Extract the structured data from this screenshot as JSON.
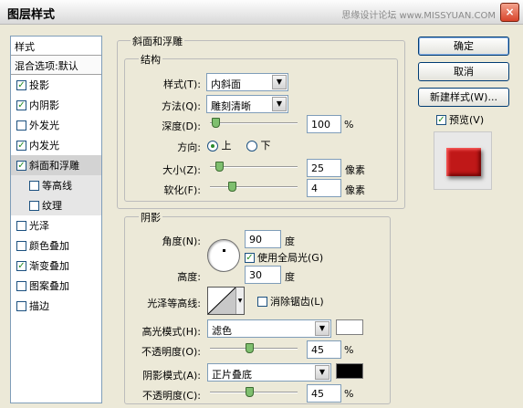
{
  "window": {
    "title": "图层样式",
    "watermark": "思缘设计论坛 www.MISSYUAN.COM",
    "close_glyph": "×"
  },
  "stylelist": {
    "header": "样式",
    "blend": "混合选项:默认",
    "items": [
      {
        "label": "投影",
        "checked": true
      },
      {
        "label": "内阴影",
        "checked": true
      },
      {
        "label": "外发光",
        "checked": false
      },
      {
        "label": "内发光",
        "checked": true
      },
      {
        "label": "斜面和浮雕",
        "checked": true,
        "selected": true
      },
      {
        "label": "等高线",
        "checked": false
      },
      {
        "label": "纹理",
        "checked": false
      },
      {
        "label": "光泽",
        "checked": false
      },
      {
        "label": "颜色叠加",
        "checked": false
      },
      {
        "label": "渐变叠加",
        "checked": true
      },
      {
        "label": "图案叠加",
        "checked": false
      },
      {
        "label": "描边",
        "checked": false
      }
    ]
  },
  "bevel": {
    "group_title": "斜面和浮雕",
    "structure_title": "结构",
    "style_label": "样式(T):",
    "style_value": "内斜面",
    "technique_label": "方法(Q):",
    "technique_value": "雕刻清晰",
    "depth_label": "深度(D):",
    "depth_value": "100",
    "depth_unit": "%",
    "depth_level": 0.06,
    "direction_label": "方向:",
    "dir_up": "上",
    "dir_down": "下",
    "size_label": "大小(Z):",
    "size_value": "25",
    "size_unit": "像素",
    "size_level": 0.1,
    "soften_label": "软化(F):",
    "soften_value": "4",
    "soften_unit": "像素",
    "soften_level": 0.25
  },
  "shading": {
    "group_title": "阴影",
    "angle_label": "角度(N):",
    "angle_value": "90",
    "angle_unit": "度",
    "global_light_label": "使用全局光(G)",
    "global_light_checked": true,
    "altitude_label": "高度:",
    "altitude_value": "30",
    "altitude_unit": "度",
    "gloss_label": "光泽等高线:",
    "antialias_label": "消除锯齿(L)",
    "highlight_label": "高光模式(H):",
    "highlight_value": "滤色",
    "highlight_color": "#ffffff",
    "hl_opacity_label": "不透明度(O):",
    "hl_opacity_value": "45",
    "hl_opacity_unit": "%",
    "hl_opacity_level": 0.45,
    "shadow_label": "阴影模式(A):",
    "shadow_value": "正片叠底",
    "shadow_color": "#000000",
    "sh_opacity_label": "不透明度(C):",
    "sh_opacity_value": "45",
    "sh_opacity_unit": "%",
    "sh_opacity_level": 0.45
  },
  "buttons": {
    "ok": "确定",
    "cancel": "取消",
    "new_style": "新建样式(W)...",
    "preview": "预览(V)",
    "preview_checked": true
  },
  "preview_color": "#c01818",
  "check_glyph": "✓",
  "arrow_glyph": "▼"
}
